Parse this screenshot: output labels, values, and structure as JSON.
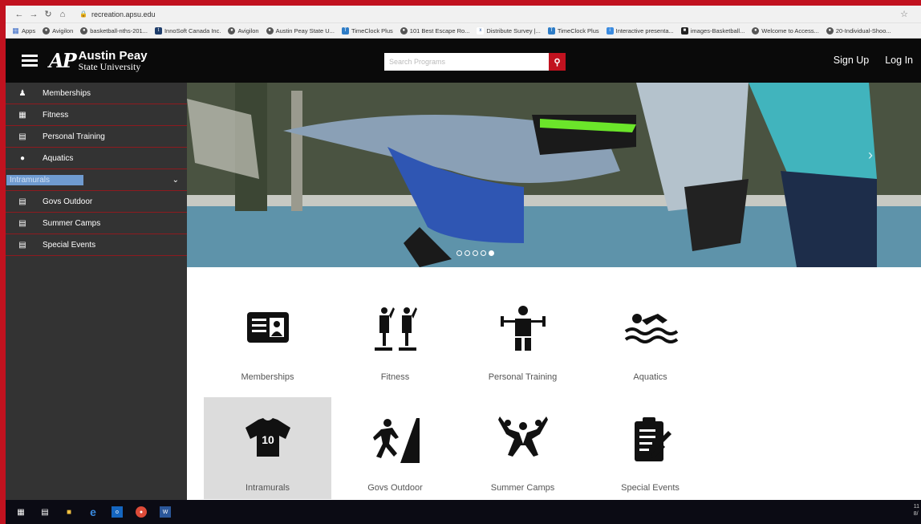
{
  "browser": {
    "url": "recreation.apsu.edu",
    "bookmarks": [
      {
        "label": "Apps",
        "icon": "apps-grid-icon"
      },
      {
        "label": "Avigilon",
        "icon": "globe-icon"
      },
      {
        "label": "basketball-nths-201...",
        "icon": "globe-icon"
      },
      {
        "label": "InnoSoft Canada Inc.",
        "icon": "t-icon"
      },
      {
        "label": "Avigilon",
        "icon": "globe-icon"
      },
      {
        "label": "Austin Peay State U...",
        "icon": "globe-icon"
      },
      {
        "label": "TimeClock Plus",
        "icon": "timeclock-icon"
      },
      {
        "label": "101 Best Escape Ro...",
        "icon": "globe-icon"
      },
      {
        "label": "Distribute Survey |...",
        "icon": "xm-icon"
      },
      {
        "label": "TimeClock Plus",
        "icon": "timeclock-icon"
      },
      {
        "label": "Interactive presenta...",
        "icon": "presentation-icon"
      },
      {
        "label": "images-Basketball...",
        "icon": "image-icon"
      },
      {
        "label": "Welcome to Access...",
        "icon": "globe-icon"
      },
      {
        "label": "20-Individual-Shoo...",
        "icon": "globe-icon"
      }
    ]
  },
  "header": {
    "logo_mark": "AP",
    "logo_name": "Austin Peay",
    "logo_sub": "State University",
    "search_placeholder": "Search Programs",
    "sign_up": "Sign Up",
    "log_in": "Log In"
  },
  "sidebar": {
    "items": [
      {
        "label": "Memberships",
        "icon": "person-icon"
      },
      {
        "label": "Fitness",
        "icon": "fitness-icon"
      },
      {
        "label": "Personal Training",
        "icon": "training-icon"
      },
      {
        "label": "Aquatics",
        "icon": "water-drop-icon"
      },
      {
        "label": "Intramurals",
        "icon": "intramurals-icon"
      },
      {
        "label": "Govs Outdoor",
        "icon": "list-icon"
      },
      {
        "label": "Summer Camps",
        "icon": "list-icon"
      },
      {
        "label": "Special Events",
        "icon": "list-icon"
      }
    ]
  },
  "hero": {
    "slide_count": 5,
    "active_slide": 5
  },
  "programs": [
    {
      "label": "Memberships",
      "icon": "id-card-icon"
    },
    {
      "label": "Fitness",
      "icon": "fitness-icon"
    },
    {
      "label": "Personal Training",
      "icon": "weightlifter-icon"
    },
    {
      "label": "Aquatics",
      "icon": "swimmer-icon"
    },
    {
      "label": "Intramurals",
      "icon": "jersey-icon",
      "jersey_number": "10"
    },
    {
      "label": "Govs Outdoor",
      "icon": "climber-icon"
    },
    {
      "label": "Summer Camps",
      "icon": "group-jump-icon"
    },
    {
      "label": "Special Events",
      "icon": "clipboard-icon"
    }
  ],
  "colors": {
    "brand_red": "#c1121f",
    "header_black": "#0a0a0a",
    "sidebar_gray": "#333333",
    "selected_tile": "#dcdcdc"
  },
  "taskbar": {
    "clock_line1": "11",
    "clock_line2": "8/"
  }
}
